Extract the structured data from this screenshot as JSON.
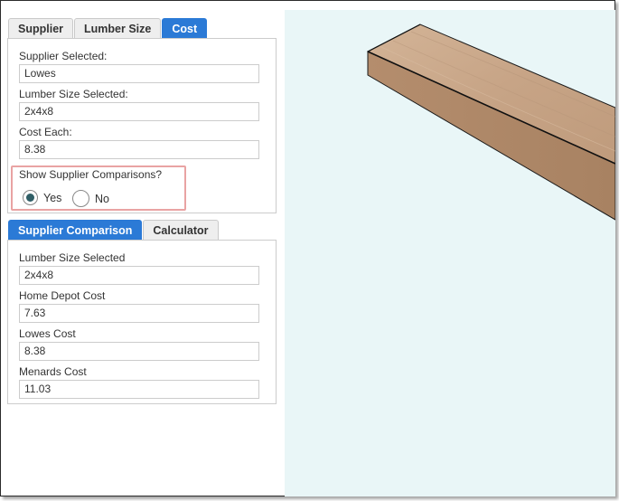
{
  "top_tabs": {
    "items": [
      {
        "label": "Supplier",
        "active": false
      },
      {
        "label": "Lumber Size",
        "active": false
      },
      {
        "label": "Cost",
        "active": true
      }
    ]
  },
  "cost_panel": {
    "supplier_label": "Supplier Selected:",
    "supplier_value": "Lowes",
    "lumber_label": "Lumber Size Selected:",
    "lumber_value": "2x4x8",
    "cost_label": "Cost Each:",
    "cost_value": "8.38",
    "comparison_question": "Show Supplier Comparisons?",
    "yes_label": "Yes",
    "no_label": "No",
    "selected_option": "Yes"
  },
  "bottom_tabs": {
    "items": [
      {
        "label": "Supplier Comparison",
        "active": true
      },
      {
        "label": "Calculator",
        "active": false
      }
    ]
  },
  "comparison_panel": {
    "lumber_label": "Lumber Size Selected",
    "lumber_value": "2x4x8",
    "home_depot_label": "Home Depot Cost",
    "home_depot_value": "7.63",
    "lowes_label": "Lowes Cost",
    "lowes_value": "8.38",
    "menards_label": "Menards Cost",
    "menards_value": "11.03"
  },
  "colors": {
    "accent": "#2b7ad6",
    "viewport_bg": "#e9f6f7",
    "wood_top": "#c8a68a",
    "wood_side": "#b08868",
    "highlight_border": "#e9a3a3"
  }
}
